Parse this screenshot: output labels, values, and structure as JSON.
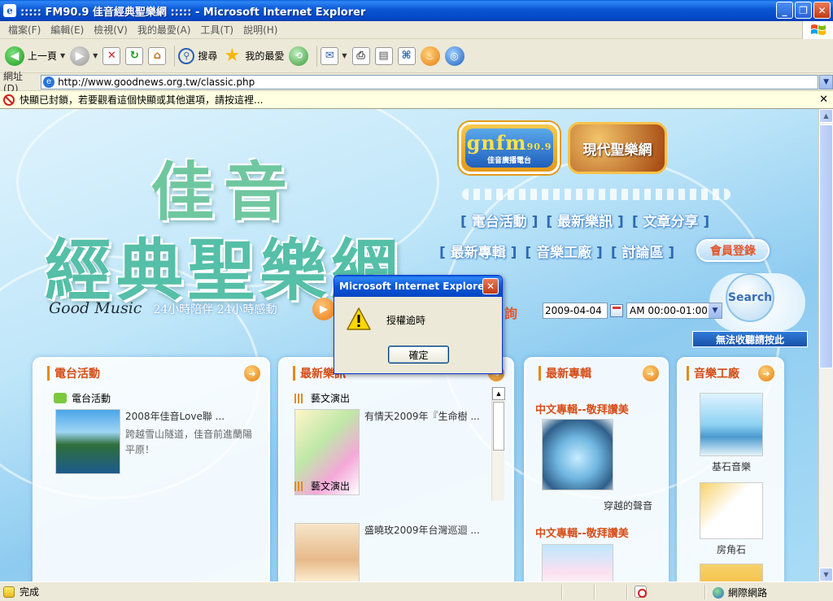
{
  "window": {
    "title": "::::: FM90.9 佳音經典聖樂網 ::::: - Microsoft Internet Explorer",
    "controls": {
      "minimize": "_",
      "maximize": "❐",
      "close": "✕"
    }
  },
  "menu": [
    "檔案(F)",
    "編輯(E)",
    "檢視(V)",
    "我的最愛(A)",
    "工具(T)",
    "說明(H)"
  ],
  "toolbar": {
    "back_label": "上一頁",
    "search_label": "搜尋",
    "favorites_label": "我的最愛"
  },
  "address": {
    "label": "網址(D)",
    "url": "http://www.goodnews.org.tw/classic.php"
  },
  "infobar": {
    "text": "快顯已封鎖，若要觀看這個快顯或其他選項，請按這裡..."
  },
  "site": {
    "logo_line1": "佳音",
    "logo_line2": "經典聖樂網",
    "slogan_en": "Good Music",
    "slogan_zh": "24小時陪伴 24小時感動",
    "fm_logo": {
      "main": "gnfm",
      "number": "90.9",
      "sub": "佳音廣播電台"
    },
    "modern_logo": "現代聖樂網",
    "nav_row1": [
      "電台活動",
      "最新樂訊",
      "文章分享"
    ],
    "nav_row2": [
      "最新專輯",
      "音樂工廠",
      "討論區"
    ],
    "member_button": "會員登錄",
    "search_button": "Search",
    "query_label": "詢",
    "date_value": "2009-04-04",
    "time_value": "AM 00:00-01:00",
    "collect_button": "無法收聽請按此"
  },
  "panels": {
    "station": {
      "title": "電台活動",
      "category": "電台活動",
      "item_title": "2008年佳音Love聯 ...",
      "item_desc": "跨越雪山隧道，佳音前進蘭陽平原！"
    },
    "news": {
      "title": "最新樂訊",
      "item1_cat": "藝文演出",
      "item1_title": "有情天2009年『生命樹 ...",
      "item2_cat": "藝文演出",
      "item2_title": "盛曉玫2009年台灣巡迴 ..."
    },
    "albums": {
      "title": "最新專輯",
      "cat1": "中文專輯--敬拜讚美",
      "album1": "穿越的聲音",
      "cat2": "中文專輯--敬拜讚美"
    },
    "factory": {
      "title": "音樂工廠",
      "item1": "基石音樂",
      "item2": "房角石"
    }
  },
  "status": {
    "text": "完成",
    "zone": "網際網路"
  },
  "dialog": {
    "title": "Microsoft Internet Explorer",
    "message": "授權逾時",
    "ok_label": "確定"
  }
}
